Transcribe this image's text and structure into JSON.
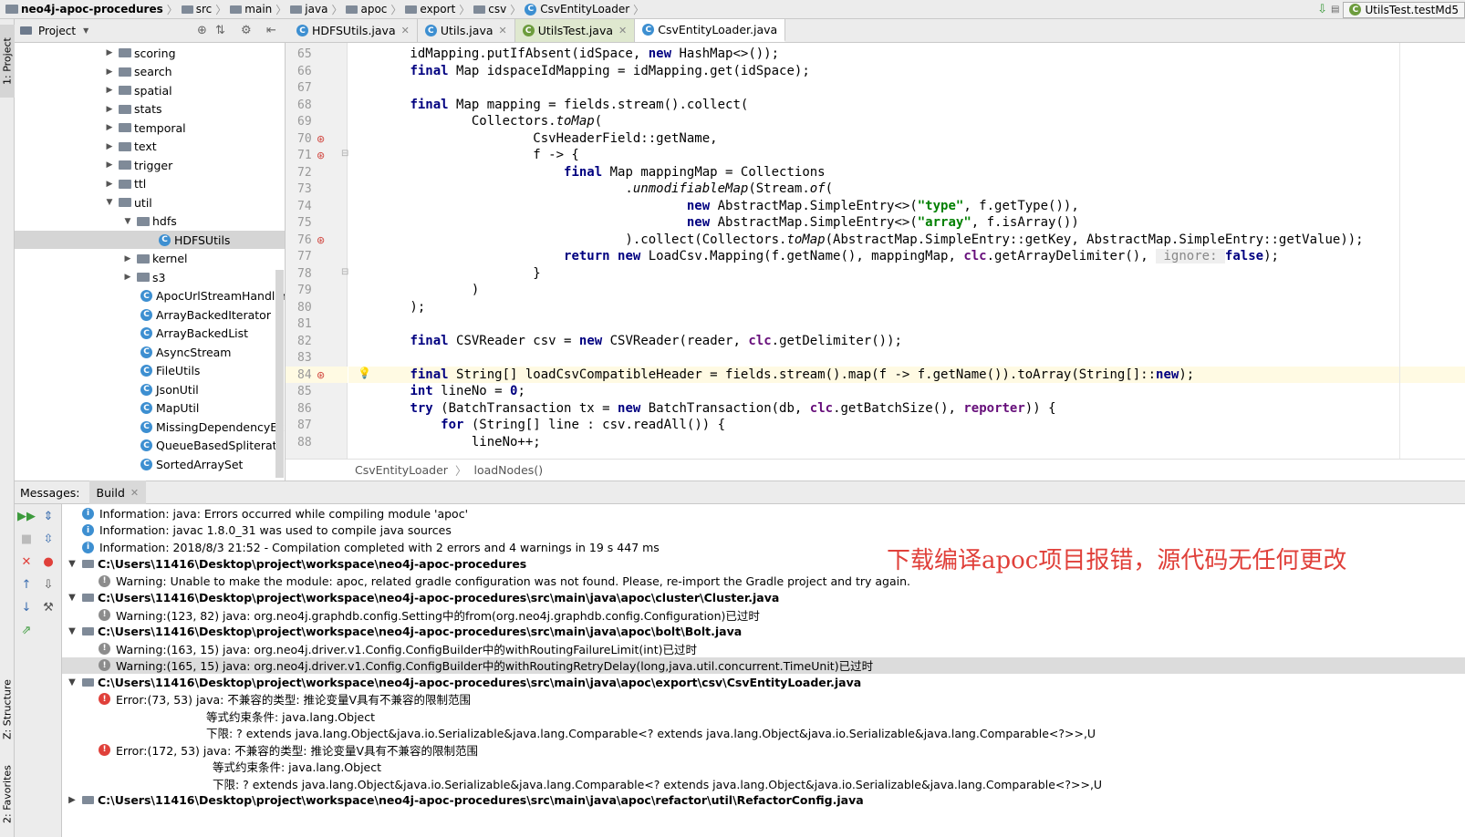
{
  "breadcrumb": {
    "project": "neo4j-apoc-procedures",
    "items": [
      "src",
      "main",
      "java",
      "apoc",
      "export",
      "csv"
    ],
    "file": "CsvEntityLoader"
  },
  "run_config": "UtilsTest.testMd5",
  "left_strip": {
    "project": "1: Project",
    "structure": "Z: Structure",
    "favorites": "2: Favorites"
  },
  "project_header": "Project",
  "tree": [
    {
      "label": "scoring",
      "kind": "folder",
      "depth": 0,
      "expanded": false
    },
    {
      "label": "search",
      "kind": "folder",
      "depth": 0,
      "expanded": false
    },
    {
      "label": "spatial",
      "kind": "folder",
      "depth": 0,
      "expanded": false
    },
    {
      "label": "stats",
      "kind": "folder",
      "depth": 0,
      "expanded": false
    },
    {
      "label": "temporal",
      "kind": "folder",
      "depth": 0,
      "expanded": false
    },
    {
      "label": "text",
      "kind": "folder",
      "depth": 0,
      "expanded": false
    },
    {
      "label": "trigger",
      "kind": "folder",
      "depth": 0,
      "expanded": false
    },
    {
      "label": "ttl",
      "kind": "folder",
      "depth": 0,
      "expanded": false
    },
    {
      "label": "util",
      "kind": "folder",
      "depth": 0,
      "expanded": true
    },
    {
      "label": "hdfs",
      "kind": "folder",
      "depth": 1,
      "expanded": true
    },
    {
      "label": "HDFSUtils",
      "kind": "class",
      "depth": 2,
      "selected": true
    },
    {
      "label": "kernel",
      "kind": "folder",
      "depth": 1,
      "expanded": false
    },
    {
      "label": "s3",
      "kind": "folder",
      "depth": 1,
      "expanded": false
    },
    {
      "label": "ApocUrlStreamHandlerFa",
      "kind": "class",
      "depth": 1
    },
    {
      "label": "ArrayBackedIterator",
      "kind": "class",
      "depth": 1
    },
    {
      "label": "ArrayBackedList",
      "kind": "class",
      "depth": 1
    },
    {
      "label": "AsyncStream",
      "kind": "class",
      "depth": 1
    },
    {
      "label": "FileUtils",
      "kind": "class",
      "depth": 1
    },
    {
      "label": "JsonUtil",
      "kind": "class",
      "depth": 1
    },
    {
      "label": "MapUtil",
      "kind": "class",
      "depth": 1
    },
    {
      "label": "MissingDependencyExce",
      "kind": "class",
      "depth": 1
    },
    {
      "label": "QueueBasedSpliterator",
      "kind": "class",
      "depth": 1
    },
    {
      "label": "SortedArraySet",
      "kind": "class",
      "depth": 1
    }
  ],
  "tabs": [
    {
      "label": "HDFSUtils.java",
      "active": false
    },
    {
      "label": "Utils.java",
      "active": false
    },
    {
      "label": "UtilsTest.java",
      "active": false,
      "test": true
    },
    {
      "label": "CsvEntityLoader.java",
      "active": true
    }
  ],
  "code_lines": [
    {
      "n": "65",
      "html": "        idMapping.putIfAbsent(idSpace, <span class=kw>new</span> HashMap<>());"
    },
    {
      "n": "66",
      "html": "        <span class=kw>final</span> Map<String, Long> idspaceIdMapping = idMapping.get(idSpace);"
    },
    {
      "n": "67",
      "html": ""
    },
    {
      "n": "68",
      "html": "        <span class=kw>final</span> Map<String, LoadCsv.Mapping> mapping = fields.stream().collect("
    },
    {
      "n": "69",
      "html": "                Collectors.<span class=it>toMap</span>("
    },
    {
      "n": "70",
      "html": "                        CsvHeaderField::getName,"
    },
    {
      "n": "71",
      "html": "                        f -> {"
    },
    {
      "n": "72",
      "html": "                            <span class=kw>final</span> Map<String, Object> mappingMap = Collections"
    },
    {
      "n": "73",
      "html": "                                    .<span class=it>unmodifiableMap</span>(Stream.<span class=it>of</span>("
    },
    {
      "n": "74",
      "html": "                                            <span class=kw>new</span> AbstractMap.SimpleEntry<>(<span class=str>\"type\"</span>, f.getType()),"
    },
    {
      "n": "75",
      "html": "                                            <span class=kw>new</span> AbstractMap.SimpleEntry<>(<span class=str>\"array\"</span>, f.isArray())"
    },
    {
      "n": "76",
      "html": "                                    ).collect(Collectors.<span class=it>toMap</span>(AbstractMap.SimpleEntry::getKey, AbstractMap.SimpleEntry::getValue));"
    },
    {
      "n": "77",
      "html": "                            <span class=kw>return new</span> LoadCsv.Mapping(f.getName(), mappingMap, <span class=fld>clc</span>.getArrayDelimiter(), <span class=hint> ignore: </span><span class=kw>false</span>);"
    },
    {
      "n": "78",
      "html": "                        }"
    },
    {
      "n": "79",
      "html": "                )"
    },
    {
      "n": "80",
      "html": "        );"
    },
    {
      "n": "81",
      "html": ""
    },
    {
      "n": "82",
      "html": "        <span class=kw>final</span> CSVReader csv = <span class=kw>new</span> CSVReader(reader, <span class=fld>clc</span>.getDelimiter());"
    },
    {
      "n": "83",
      "html": ""
    },
    {
      "n": "84",
      "html": "        <span class=kw>final</span> String[] loadCsvCompatibleHeader = fields.stream().map(f -> f.getName()).toArray(String[]::<span class=kw>new</span>);",
      "cur": true
    },
    {
      "n": "85",
      "html": "        <span class=kw>int</span> lineNo = <span class=kw>0</span>;"
    },
    {
      "n": "86",
      "html": "        <span class=kw>try</span> (BatchTransaction tx = <span class=kw>new</span> BatchTransaction(db, <span class=fld>clc</span>.getBatchSize(), <span class=fld>reporter</span>)) {"
    },
    {
      "n": "87",
      "html": "            <span class=kw>for</span> (String[] line : csv.readAll()) {"
    },
    {
      "n": "88",
      "html": "                lineNo++;"
    }
  ],
  "editor_crumb": {
    "cls": "CsvEntityLoader",
    "method": "loadNodes()"
  },
  "messages_header": {
    "label": "Messages:",
    "tab": "Build"
  },
  "messages": [
    {
      "icon": "info",
      "indent": 0,
      "text": "Information: java: Errors occurred while compiling module 'apoc'"
    },
    {
      "icon": "info",
      "indent": 0,
      "text": "Information: javac 1.8.0_31 was used to compile java sources"
    },
    {
      "icon": "info",
      "indent": 0,
      "text": "Information: 2018/8/3 21:52 - Compilation completed with 2 errors and 4 warnings in 19 s 447 ms"
    },
    {
      "icon": "file",
      "indent": 0,
      "tw": "v",
      "bold": true,
      "text": "C:\\Users\\11416\\Desktop\\project\\workspace\\neo4j-apoc-procedures"
    },
    {
      "icon": "warn",
      "indent": 1,
      "text": "Warning: Unable to make the module: apoc, related gradle configuration was not found. Please, re-import the Gradle project and try again."
    },
    {
      "icon": "file",
      "indent": 0,
      "tw": "v",
      "bold": true,
      "text": "C:\\Users\\11416\\Desktop\\project\\workspace\\neo4j-apoc-procedures\\src\\main\\java\\apoc\\cluster\\Cluster.java"
    },
    {
      "icon": "warn",
      "indent": 1,
      "text": "Warning:(123, 82)  java: org.neo4j.graphdb.config.Setting中的from(org.neo4j.graphdb.config.Configuration)已过时"
    },
    {
      "icon": "file",
      "indent": 0,
      "tw": "v",
      "bold": true,
      "text": "C:\\Users\\11416\\Desktop\\project\\workspace\\neo4j-apoc-procedures\\src\\main\\java\\apoc\\bolt\\Bolt.java"
    },
    {
      "icon": "warn",
      "indent": 1,
      "text": "Warning:(163, 15)  java: org.neo4j.driver.v1.Config.ConfigBuilder中的withRoutingFailureLimit(int)已过时"
    },
    {
      "icon": "warn",
      "indent": 1,
      "sel": true,
      "text": "Warning:(165, 15)  java: org.neo4j.driver.v1.Config.ConfigBuilder中的withRoutingRetryDelay(long,java.util.concurrent.TimeUnit)已过时"
    },
    {
      "icon": "file",
      "indent": 0,
      "tw": "v",
      "bold": true,
      "text": "C:\\Users\\11416\\Desktop\\project\\workspace\\neo4j-apoc-procedures\\src\\main\\java\\apoc\\export\\csv\\CsvEntityLoader.java"
    },
    {
      "icon": "err",
      "indent": 1,
      "text": "Error:(73, 53)  java: 不兼容的类型: 推论变量V具有不兼容的限制范围"
    },
    {
      "icon": "none",
      "indent": 2,
      "pad": 96,
      "text": "等式约束条件: java.lang.Object"
    },
    {
      "icon": "none",
      "indent": 2,
      "pad": 96,
      "text": "下限: ? extends java.lang.Object&java.io.Serializable&java.lang.Comparable<? extends java.lang.Object&java.io.Serializable&java.lang.Comparable<?>>,U"
    },
    {
      "icon": "err",
      "indent": 1,
      "text": "Error:(172, 53)  java: 不兼容的类型: 推论变量V具有不兼容的限制范围"
    },
    {
      "icon": "none",
      "indent": 2,
      "pad": 103,
      "text": "等式约束条件: java.lang.Object"
    },
    {
      "icon": "none",
      "indent": 2,
      "pad": 103,
      "text": "下限: ? extends java.lang.Object&java.io.Serializable&java.lang.Comparable<? extends java.lang.Object&java.io.Serializable&java.lang.Comparable<?>>,U"
    },
    {
      "icon": "file",
      "indent": 0,
      "tw": ">",
      "bold": true,
      "text": "C:\\Users\\11416\\Desktop\\project\\workspace\\neo4j-apoc-procedures\\src\\main\\java\\apoc\\refactor\\util\\RefactorConfig.java"
    }
  ],
  "annotation": "下载编译apoc项目报错，源代码无任何更改",
  "colors": {
    "error": "#e0403a",
    "info": "#3d8fd1",
    "keyword": "#000080",
    "string": "#008000"
  }
}
